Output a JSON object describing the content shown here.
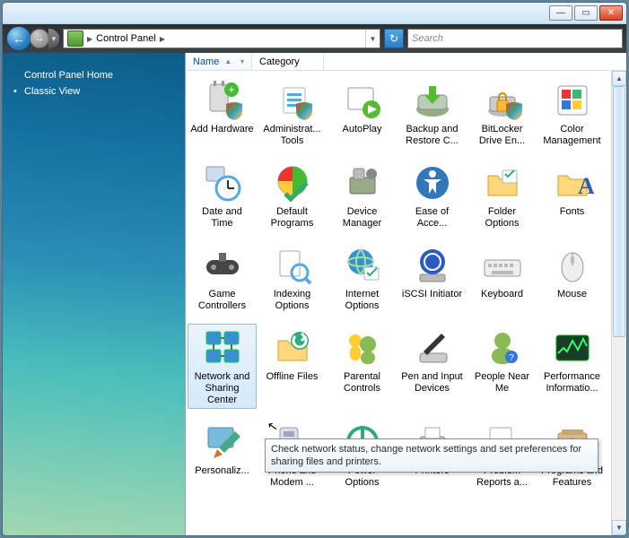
{
  "titlebar": {
    "min": "—",
    "max": "▭",
    "close": "✕"
  },
  "address": {
    "segments": [
      "Control Panel"
    ],
    "refresh": "↻"
  },
  "search": {
    "placeholder": "Search"
  },
  "sidebar": {
    "items": [
      {
        "label": "Control Panel Home",
        "bullet": false
      },
      {
        "label": "Classic View",
        "bullet": true
      }
    ]
  },
  "columns": [
    {
      "label": "Name",
      "sorted": true
    },
    {
      "label": "Category",
      "sorted": false
    }
  ],
  "tooltip": "Check network status, change network settings and set preferences for sharing files and printers.",
  "items": [
    {
      "label": "Add Hardware",
      "icon": "plug-icon"
    },
    {
      "label": "Administrat... Tools",
      "icon": "tools-icon"
    },
    {
      "label": "AutoPlay",
      "icon": "autoplay-icon"
    },
    {
      "label": "Backup and Restore C...",
      "icon": "backup-icon"
    },
    {
      "label": "BitLocker Drive En...",
      "icon": "bitlocker-icon"
    },
    {
      "label": "Color Management",
      "icon": "color-icon"
    },
    {
      "label": "Date and Time",
      "icon": "clock-icon"
    },
    {
      "label": "Default Programs",
      "icon": "default-programs-icon"
    },
    {
      "label": "Device Manager",
      "icon": "device-manager-icon"
    },
    {
      "label": "Ease of Acce...",
      "icon": "ease-of-access-icon"
    },
    {
      "label": "Folder Options",
      "icon": "folder-options-icon"
    },
    {
      "label": "Fonts",
      "icon": "fonts-icon"
    },
    {
      "label": "Game Controllers",
      "icon": "game-controllers-icon"
    },
    {
      "label": "Indexing Options",
      "icon": "indexing-icon"
    },
    {
      "label": "Internet Options",
      "icon": "internet-options-icon"
    },
    {
      "label": "iSCSI Initiator",
      "icon": "iscsi-icon"
    },
    {
      "label": "Keyboard",
      "icon": "keyboard-icon"
    },
    {
      "label": "Mouse",
      "icon": "mouse-icon"
    },
    {
      "label": "Network and Sharing Center",
      "icon": "network-icon",
      "selected": true
    },
    {
      "label": "Offline Files",
      "icon": "offline-files-icon"
    },
    {
      "label": "Parental Controls",
      "icon": "parental-icon"
    },
    {
      "label": "Pen and Input Devices",
      "icon": "pen-icon"
    },
    {
      "label": "People Near Me",
      "icon": "people-icon"
    },
    {
      "label": "Performance Informatio...",
      "icon": "performance-icon"
    },
    {
      "label": "Personaliz...",
      "icon": "personalization-icon"
    },
    {
      "label": "Phone and Modem ...",
      "icon": "phone-icon"
    },
    {
      "label": "Power Options",
      "icon": "power-icon"
    },
    {
      "label": "Printers",
      "icon": "printers-icon"
    },
    {
      "label": "Problem Reports a...",
      "icon": "problem-reports-icon"
    },
    {
      "label": "Programs and Features",
      "icon": "programs-icon"
    }
  ]
}
